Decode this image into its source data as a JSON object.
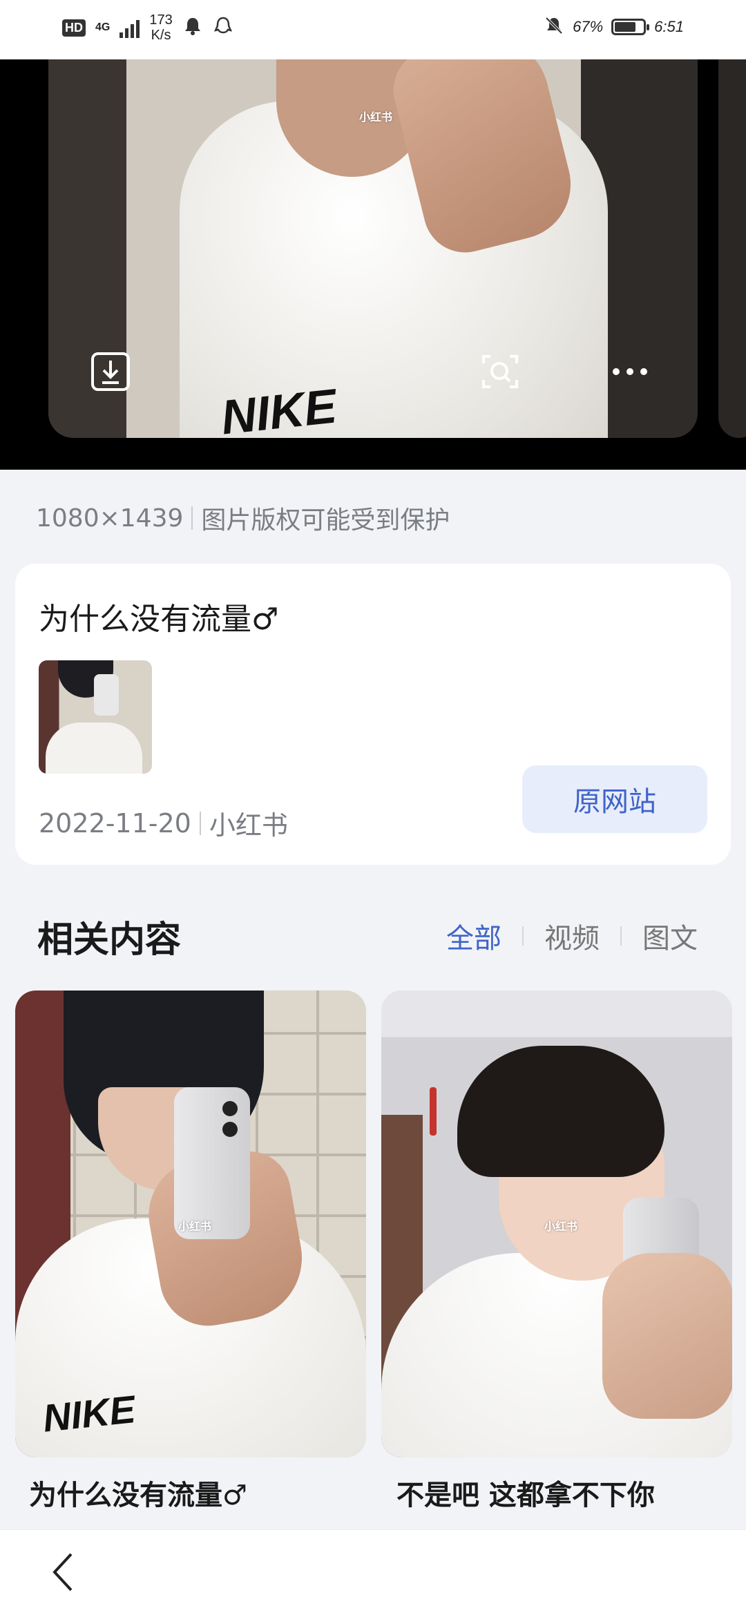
{
  "status_bar": {
    "hd": "HD",
    "network": "4G",
    "speed_value": "173",
    "speed_unit": "K/s",
    "battery_text": "67%",
    "time": "6:51"
  },
  "viewer": {
    "watermark": "小红书",
    "logo_text": "NIKE"
  },
  "image_info": {
    "dimensions": "1080×1439",
    "copyright": "图片版权可能受到保护"
  },
  "source_card": {
    "title": "为什么没有流量♂",
    "date": "2022-11-20",
    "source": "小红书",
    "button_label": "原网站"
  },
  "related": {
    "title": "相关内容",
    "filters": [
      "全部",
      "视频",
      "图文"
    ],
    "items": [
      {
        "caption": "为什么没有流量♂",
        "watermark": "小红书"
      },
      {
        "caption": "不是吧 这都拿不下你",
        "watermark": "小红书"
      }
    ]
  },
  "colors": {
    "accent": "#3f63c8",
    "button_bg": "#e8edfb",
    "page_bg": "#f2f3f6"
  }
}
